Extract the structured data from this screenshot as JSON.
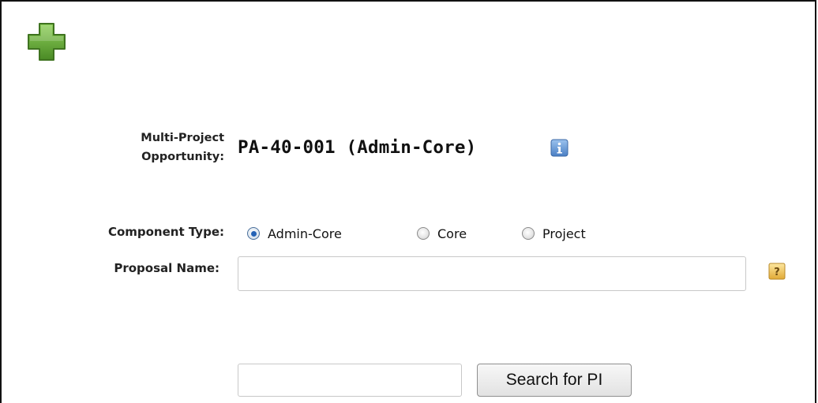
{
  "icons": {
    "add": "plus-icon",
    "info": "info-icon",
    "help": "help-icon",
    "add_color": "#6aa53a",
    "info_color": "#5b8fd0",
    "help_color": "#e8b84a"
  },
  "opportunity": {
    "label_line1": "Multi-Project",
    "label_line2": "Opportunity:",
    "value": "PA-40-001 (Admin-Core)"
  },
  "component_type": {
    "label": "Component Type:",
    "options": [
      {
        "label": "Admin-Core",
        "checked": true
      },
      {
        "label": "Core",
        "checked": false
      },
      {
        "label": "Project",
        "checked": false
      }
    ]
  },
  "proposal_name": {
    "label": "Proposal Name:",
    "value": ""
  },
  "pi_search": {
    "input_value": "",
    "button_label": "Search for PI"
  }
}
